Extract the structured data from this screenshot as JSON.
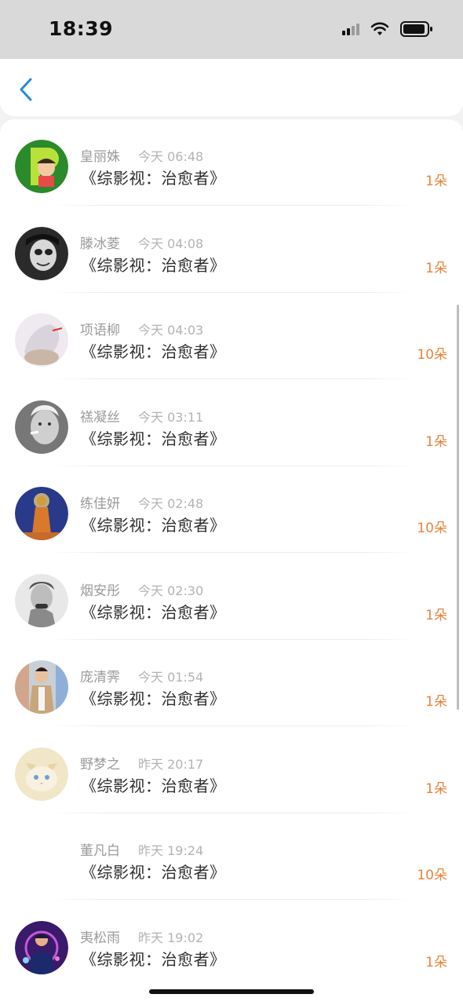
{
  "status_bar": {
    "time": "18:39",
    "icons": [
      "signal-icon",
      "wifi-icon",
      "battery-icon"
    ]
  },
  "nav": {
    "back_icon": "chevron-left-icon",
    "accent_color": "#2a8ad8"
  },
  "colors": {
    "count": "#e8833a",
    "name": "#9a9a9a",
    "time": "#b3b3b3",
    "title": "#2e2e2e"
  },
  "items": [
    {
      "name": "皇丽姝",
      "time": "今天 06:48",
      "title": "《综影视：治愈者》",
      "count": "1朵",
      "avatar": "cartoon-p-avatar"
    },
    {
      "name": "滕冰菱",
      "time": "今天 04:08",
      "title": "《综影视：治愈者》",
      "count": "1朵",
      "avatar": "sketch-face-avatar"
    },
    {
      "name": "项语柳",
      "time": "今天 04:03",
      "title": "《综影视：治愈者》",
      "count": "10朵",
      "avatar": "anime-avatar"
    },
    {
      "name": "禚凝丝",
      "time": "今天 03:11",
      "title": "《综影视：治愈者》",
      "count": "1朵",
      "avatar": "smoking-man-avatar"
    },
    {
      "name": "练佳妍",
      "time": "今天 02:48",
      "title": "《综影视：治愈者》",
      "count": "10朵",
      "avatar": "buddha-avatar"
    },
    {
      "name": "烟安彤",
      "time": "今天 02:30",
      "title": "《综影视：治愈者》",
      "count": "1朵",
      "avatar": "man-portrait-avatar"
    },
    {
      "name": "庞清霁",
      "time": "今天 01:54",
      "title": "《综影视：治愈者》",
      "count": "1朵",
      "avatar": "street-person-avatar"
    },
    {
      "name": "野梦之",
      "time": "昨天 20:17",
      "title": "《综影视：治愈者》",
      "count": "1朵",
      "avatar": "cat-avatar"
    },
    {
      "name": "董凡白",
      "time": "昨天 19:24",
      "title": "《综影视：治愈者》",
      "count": "10朵",
      "avatar": "none"
    },
    {
      "name": "夷松雨",
      "time": "昨天 19:02",
      "title": "《综影视：治愈者》",
      "count": "1朵",
      "avatar": "dj-avatar"
    }
  ]
}
